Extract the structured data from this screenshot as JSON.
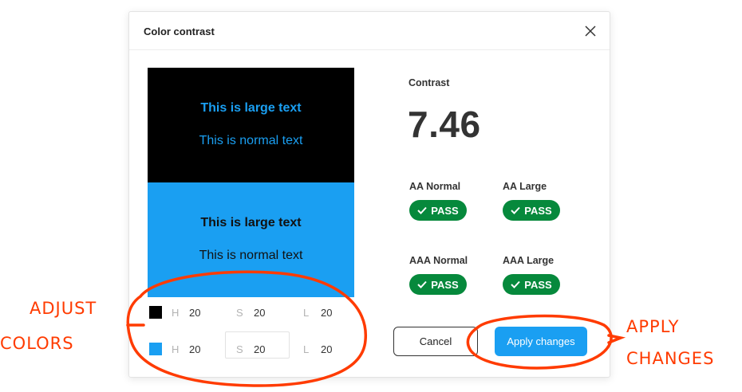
{
  "dialog": {
    "title": "Color contrast",
    "close_icon": "close-icon"
  },
  "preview": {
    "dark": {
      "background": "#000000",
      "text_color": "#1a9ff2",
      "large_text": "This is large text",
      "normal_text": "This is normal text"
    },
    "light": {
      "background": "#1a9ff2",
      "text_color": "#111111",
      "large_text": "This is large text",
      "normal_text": "This is normal text"
    }
  },
  "colors": [
    {
      "swatch": "#000000",
      "h_label": "H",
      "h": "20",
      "s_label": "S",
      "s": "20",
      "l_label": "L",
      "l": "20"
    },
    {
      "swatch": "#1a9ff2",
      "h_label": "H",
      "h": "20",
      "s_label": "S",
      "s": "20",
      "l_label": "L",
      "l": "20"
    }
  ],
  "contrast": {
    "label": "Contrast",
    "value": "7.46"
  },
  "criteria": [
    {
      "name": "AA Normal",
      "result": "PASS"
    },
    {
      "name": "AA Large",
      "result": "PASS"
    },
    {
      "name": "AAA Normal",
      "result": "PASS"
    },
    {
      "name": "AAA Large",
      "result": "PASS"
    }
  ],
  "buttons": {
    "cancel": "Cancel",
    "apply": "Apply changes"
  },
  "annotations": {
    "left_line1": "ADJUST",
    "left_line2": "COLORS",
    "right_line1": "APPLY",
    "right_line2": "CHANGES",
    "color": "#ff3b00"
  },
  "theme": {
    "accent": "#1a9ff2",
    "pass_green": "#06893c"
  }
}
